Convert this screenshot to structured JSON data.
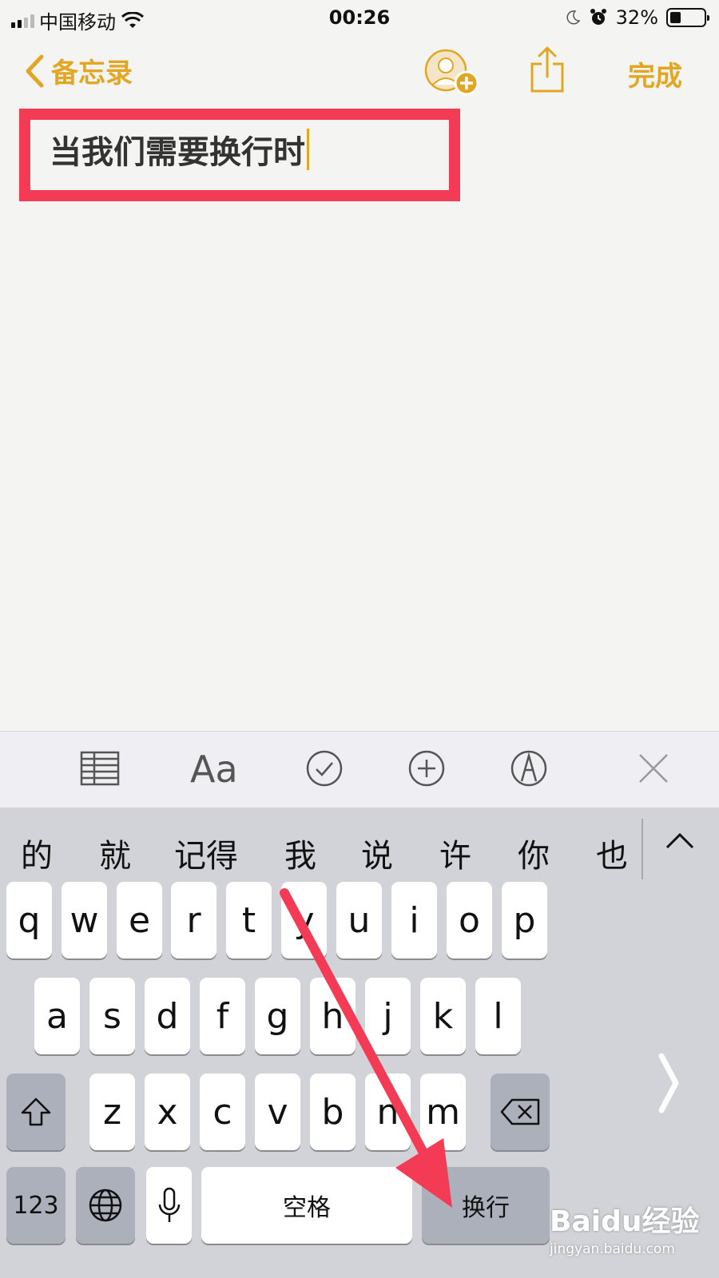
{
  "status_bar": {
    "carrier": "中国移动",
    "time": "00:26",
    "battery": "32%",
    "battery_level": 0.32
  },
  "navbar": {
    "back_label": "备忘录",
    "done_label": "完成",
    "add_person_icon": "add-person-icon",
    "share_icon": "share-icon"
  },
  "note": {
    "text": "当我们需要换行时"
  },
  "toolbar": {
    "table_icon": "table-icon",
    "format_label": "Aa",
    "checklist_icon": "checklist-icon",
    "add_icon": "plus-circle-icon",
    "markup_icon": "markup-icon",
    "close_icon": "close-icon"
  },
  "keyboard": {
    "candidates": [
      "的",
      "就",
      "记得",
      "我",
      "说",
      "许",
      "你",
      "也"
    ],
    "row1": [
      "q",
      "w",
      "e",
      "r",
      "t",
      "y",
      "u",
      "i",
      "o",
      "p"
    ],
    "row2": [
      "a",
      "s",
      "d",
      "f",
      "g",
      "h",
      "j",
      "k",
      "l"
    ],
    "row3": [
      "z",
      "x",
      "c",
      "v",
      "b",
      "n",
      "m"
    ],
    "numbers_label": "123",
    "space_label": "空格",
    "return_label": "换行"
  },
  "watermark": {
    "brand": "Baidu经验",
    "url": "jingyan.baidu.com"
  },
  "colors": {
    "accent": "#e3a623",
    "highlight": "#f43b55",
    "arrow": "#f43b55"
  }
}
